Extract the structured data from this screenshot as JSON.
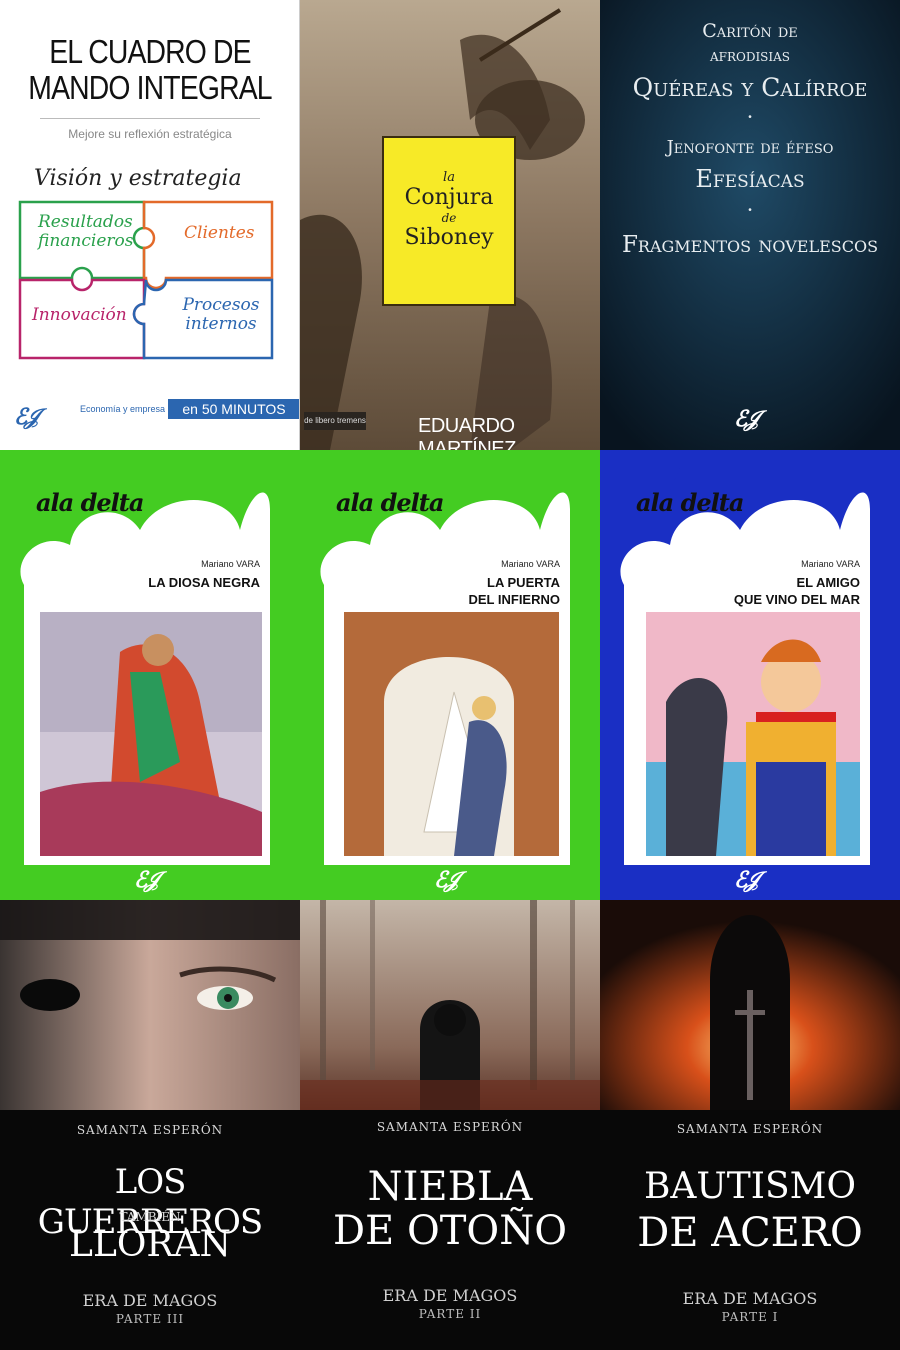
{
  "covers": [
    {
      "title_line1": "EL CUADRO DE",
      "title_line2": "MANDO INTEGRAL",
      "subtitle": "Mejore su reflexión estratégica",
      "heading": "Visión y estrategia",
      "pieces": [
        "Resultados financieros",
        "Clientes",
        "Innovación",
        "Procesos internos"
      ],
      "footer_left": "Economía y empresa",
      "footer_right": "en 50 MINUTOS",
      "logo": "ℰ𝒥"
    },
    {
      "la": "la",
      "title1": "Conjura",
      "de": "de",
      "title2": "Siboney",
      "publisher": "de libero tremens",
      "author": "EDUARDO MARTÍNEZ"
    },
    {
      "line1": "Caritón de",
      "line2": "afrodisias",
      "line3": "Quéreas y Calírroe",
      "line4": "Jenofonte de éfeso",
      "line5": "Efesíacas",
      "line6": "Fragmentos novelescos",
      "dot": "•"
    },
    {
      "brand": "ala delta",
      "author": "Mariano VARA",
      "title1": "LA DIOSA NEGRA",
      "title2": ""
    },
    {
      "brand": "ala delta",
      "author": "Mariano VARA",
      "title1": "LA PUERTA",
      "title2": "DEL INFIERNO"
    },
    {
      "brand": "ala delta",
      "author": "Mariano VARA",
      "title1": "EL AMIGO",
      "title2": "QUE VINO DEL MAR"
    },
    {
      "author": "SAMANTA ESPERÓN",
      "t1": "LOS GUERREROS",
      "t2": "TAMBIÉN",
      "t3": "LLORAN",
      "era": "ERA DE MAGOS",
      "part": "PARTE III"
    },
    {
      "author": "SAMANTA ESPERÓN",
      "t1": "NIEBLA",
      "t2": "DE OTOÑO",
      "era": "ERA DE MAGOS",
      "part": "PARTE II"
    },
    {
      "author": "SAMANTA ESPERÓN",
      "t1": "BAUTISMO",
      "t2": "DE ACERO",
      "era": "ERA DE MAGOS",
      "part": "PARTE I"
    }
  ],
  "colors": {
    "green": "#44cc22",
    "blue": "#1a2fc4",
    "navy": "#0e2233",
    "yellow": "#f7ea27"
  }
}
